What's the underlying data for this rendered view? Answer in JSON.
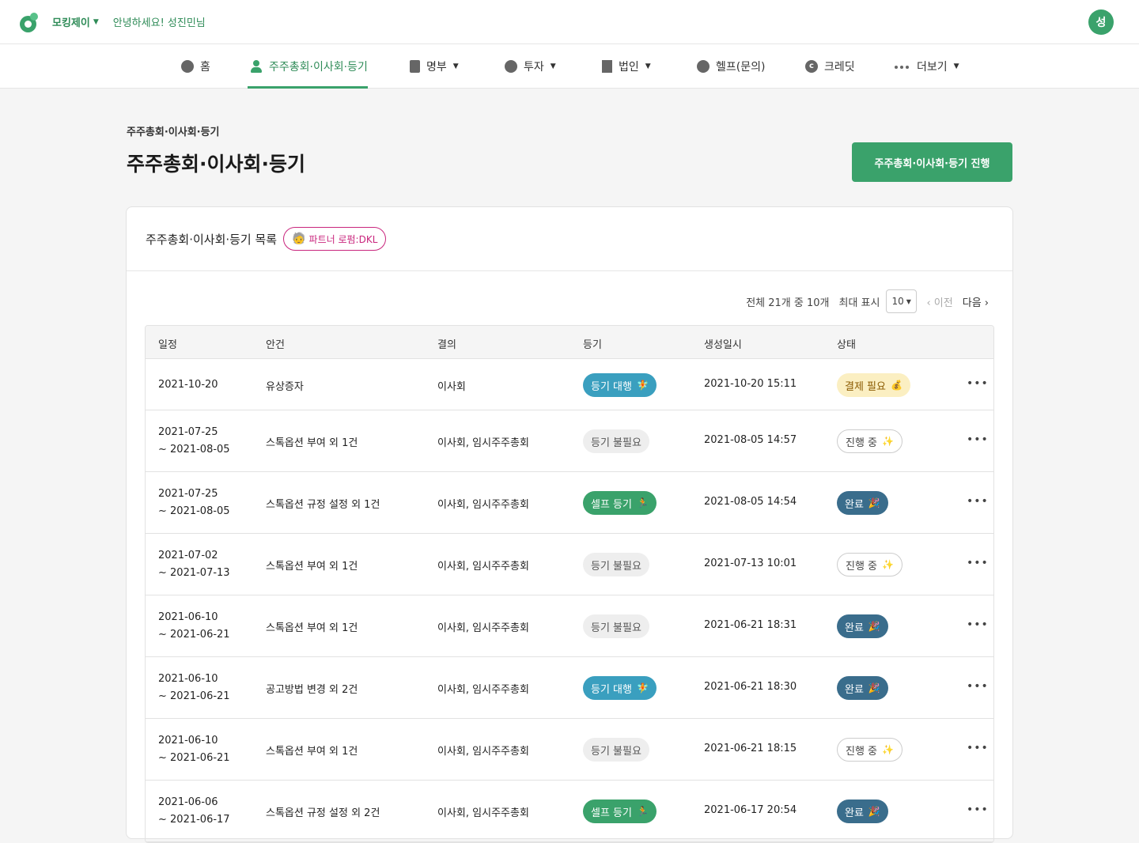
{
  "header": {
    "company": "모킹제이",
    "greeting": "안녕하세요! 성진민님",
    "avatar_initial": "성"
  },
  "nav": {
    "items": [
      {
        "label": "홈",
        "icon": "compass-icon"
      },
      {
        "label": "주주총회·이사회·등기",
        "icon": "user-icon",
        "active": true
      },
      {
        "label": "명부",
        "icon": "document-icon",
        "dropdown": true
      },
      {
        "label": "투자",
        "icon": "pie-chart-icon",
        "dropdown": true
      },
      {
        "label": "법인",
        "icon": "building-icon",
        "dropdown": true
      },
      {
        "label": "헬프(문의)",
        "icon": "chat-icon"
      },
      {
        "label": "크레딧",
        "icon": "credit-icon"
      },
      {
        "label": "더보기",
        "icon": "more-dots-icon",
        "dropdown": true
      }
    ]
  },
  "page": {
    "breadcrumb": "주주총회·이사회·등기",
    "title": "주주총회·이사회·등기",
    "primary_button": "주주총회·이사회·등기 진행"
  },
  "list": {
    "title": "주주총회·이사회·등기 목록",
    "partner_badge": "파트너 로펌:DKL",
    "partner_emoji": "🧓",
    "pager": {
      "summary": "전체 21개 중 10개",
      "max_label": "최대 표시",
      "page_size": "10",
      "prev": "‹ 이전",
      "next": "다음 ›"
    },
    "columns": [
      "일정",
      "안건",
      "결의",
      "등기",
      "생성일시",
      "상태"
    ],
    "rows": [
      {
        "date1": "2021-10-20",
        "date2": "",
        "agenda": "유상증자",
        "resolution": "이사회",
        "registry": "등기 대행",
        "registry_type": "proxy",
        "registry_emoji": "🧚",
        "created": "2021-10-20 15:11",
        "status": "결제 필요",
        "status_type": "pay",
        "status_emoji": "💰"
      },
      {
        "date1": "2021-07-25",
        "date2": "~ 2021-08-05",
        "agenda": "스톡옵션 부여 외 1건",
        "resolution": "이사회, 임시주주총회",
        "registry": "등기 불필요",
        "registry_type": "none",
        "registry_emoji": "",
        "created": "2021-08-05 14:57",
        "status": "진행 중",
        "status_type": "prog",
        "status_emoji": "✨"
      },
      {
        "date1": "2021-07-25",
        "date2": "~ 2021-08-05",
        "agenda": "스톡옵션 규정 설정 외 1건",
        "resolution": "이사회, 임시주주총회",
        "registry": "셀프 등기",
        "registry_type": "self",
        "registry_emoji": "🏃",
        "created": "2021-08-05 14:54",
        "status": "완료",
        "status_type": "done",
        "status_emoji": "🎉"
      },
      {
        "date1": "2021-07-02",
        "date2": "~ 2021-07-13",
        "agenda": "스톡옵션 부여 외 1건",
        "resolution": "이사회, 임시주주총회",
        "registry": "등기 불필요",
        "registry_type": "none",
        "registry_emoji": "",
        "created": "2021-07-13 10:01",
        "status": "진행 중",
        "status_type": "prog",
        "status_emoji": "✨"
      },
      {
        "date1": "2021-06-10",
        "date2": "~ 2021-06-21",
        "agenda": "스톡옵션 부여 외 1건",
        "resolution": "이사회, 임시주주총회",
        "registry": "등기 불필요",
        "registry_type": "none",
        "registry_emoji": "",
        "created": "2021-06-21 18:31",
        "status": "완료",
        "status_type": "done",
        "status_emoji": "🎉"
      },
      {
        "date1": "2021-06-10",
        "date2": "~ 2021-06-21",
        "agenda": "공고방법 변경 외 2건",
        "resolution": "이사회, 임시주주총회",
        "registry": "등기 대행",
        "registry_type": "proxy",
        "registry_emoji": "🧚",
        "created": "2021-06-21 18:30",
        "status": "완료",
        "status_type": "done",
        "status_emoji": "🎉"
      },
      {
        "date1": "2021-06-10",
        "date2": "~ 2021-06-21",
        "agenda": "스톡옵션 부여 외 1건",
        "resolution": "이사회, 임시주주총회",
        "registry": "등기 불필요",
        "registry_type": "none",
        "registry_emoji": "",
        "created": "2021-06-21 18:15",
        "status": "진행 중",
        "status_type": "prog",
        "status_emoji": "✨"
      },
      {
        "date1": "2021-06-06",
        "date2": "~ 2021-06-17",
        "agenda": "스톡옵션 규정 설정 외 2건",
        "resolution": "이사회, 임시주주총회",
        "registry": "셀프 등기",
        "registry_type": "self",
        "registry_emoji": "🏃",
        "created": "2021-06-17 20:54",
        "status": "완료",
        "status_type": "done",
        "status_emoji": "🎉"
      }
    ],
    "row_menu": "•••"
  }
}
